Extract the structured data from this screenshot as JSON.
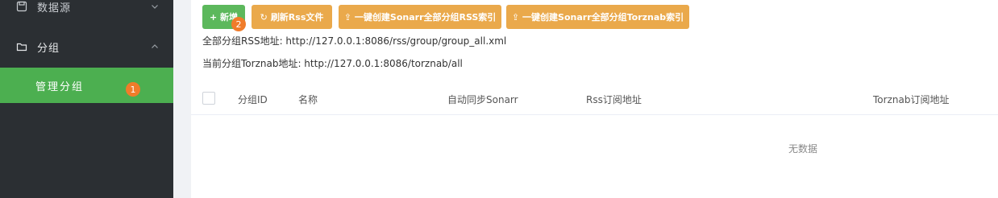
{
  "sidebar": {
    "source_item": {
      "label": "数据源",
      "icon": "save-icon"
    },
    "group_item": {
      "label": "分组",
      "icon": "folder-icon"
    },
    "active_subitem": {
      "label": "管理分组"
    },
    "badge": "1"
  },
  "toolbar": {
    "add_label": "+ 新增",
    "add_badge": "2",
    "refresh_label": "刷新Rss文件",
    "sonarr_rss_label": "一键创建Sonarr全部分组RSS索引",
    "sonarr_torznab_label": "一键创建Sonarr全部分组Torznab索引",
    "rss_info": "全部分组RSS地址: http://127.0.0.1:8086/rss/group/group_all.xml",
    "torznab_info": "当前分组Torznab地址: http://127.0.0.1:8086/torznab/all"
  },
  "table": {
    "columns": [
      "分组ID",
      "名称",
      "自动同步Sonarr",
      "Rss订阅地址",
      "Torznab订阅地址"
    ],
    "empty_text": "无数据"
  },
  "colors": {
    "sidebar_bg": "#2b2f33",
    "active_green": "#4caf50",
    "add_green": "#5cb85c",
    "orange_button": "#eaa94b",
    "badge_orange": "#f07c2a"
  }
}
